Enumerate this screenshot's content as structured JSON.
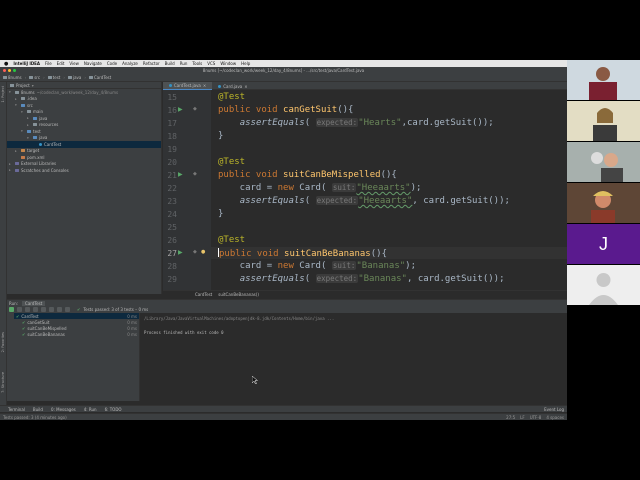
{
  "menubar": {
    "apple": "",
    "app": "IntelliJ IDEA",
    "items": [
      "File",
      "Edit",
      "View",
      "Navigate",
      "Code",
      "Analyze",
      "Refactor",
      "Build",
      "Run",
      "Tools",
      "VCS",
      "Window",
      "Help"
    ],
    "right": ""
  },
  "window": {
    "title": "8nums [~/codeclan_work/week_12/day_4/8nums] - .../src/test/java/CardTest.java"
  },
  "navbar": [
    "8nums",
    "src",
    "test",
    "java",
    "CardTest"
  ],
  "project": {
    "header": "Project",
    "rows": [
      {
        "label": "8nums",
        "detail": "~/codeclan_work/week_12/day_4/8nums",
        "icon": "folder",
        "depth": 0,
        "open": true
      },
      {
        "label": ".idea",
        "detail": "",
        "icon": "folder",
        "depth": 1,
        "open": false
      },
      {
        "label": "src",
        "detail": "",
        "icon": "folder",
        "depth": 1,
        "open": true
      },
      {
        "label": "main",
        "detail": "",
        "icon": "folder",
        "depth": 2,
        "open": true
      },
      {
        "label": "java",
        "detail": "",
        "icon": "folder",
        "depth": 3,
        "open": false
      },
      {
        "label": "resources",
        "detail": "",
        "icon": "folder",
        "depth": 3,
        "open": false
      },
      {
        "label": "test",
        "detail": "",
        "icon": "folder",
        "depth": 2,
        "open": true
      },
      {
        "label": "java",
        "detail": "",
        "icon": "folder",
        "depth": 3,
        "open": true
      },
      {
        "label": "CardTest",
        "detail": "",
        "icon": "class",
        "depth": 4,
        "open": false,
        "selected": true
      },
      {
        "label": "target",
        "detail": "",
        "icon": "folder",
        "depth": 1,
        "open": false
      },
      {
        "label": "pom.xml",
        "detail": "",
        "icon": "file",
        "depth": 1,
        "open": false
      },
      {
        "label": "External Libraries",
        "detail": "",
        "icon": "lib",
        "depth": 0,
        "open": false
      },
      {
        "label": "Scratches and Consoles",
        "detail": "",
        "icon": "lib",
        "depth": 0,
        "open": false
      }
    ]
  },
  "tabs": [
    {
      "label": "CardTest.java",
      "active": true
    },
    {
      "label": "Card.java",
      "active": false
    }
  ],
  "editor": {
    "lines": [
      {
        "n": "15",
        "tokens": [
          [
            "an",
            "@Test"
          ]
        ]
      },
      {
        "n": "16",
        "tokens": [
          [
            "kw",
            "public void "
          ],
          [
            "fn",
            "canGetSuit"
          ],
          [
            "",
            "(){"
          ]
        ]
      },
      {
        "n": "17",
        "tokens": [
          [
            "",
            "    "
          ],
          [
            "it",
            "assertEquals"
          ],
          [
            "",
            "( "
          ],
          [
            "hint",
            "expected:"
          ],
          [
            "st",
            "\"Hearts\""
          ],
          [
            "",
            ",card.getSuit());"
          ]
        ]
      },
      {
        "n": "18",
        "tokens": [
          [
            "",
            "}"
          ]
        ]
      },
      {
        "n": "19",
        "tokens": []
      },
      {
        "n": "20",
        "tokens": [
          [
            "an",
            "@Test"
          ]
        ]
      },
      {
        "n": "21",
        "tokens": [
          [
            "kw",
            "public void "
          ],
          [
            "fn",
            "suitCanBeMispelled"
          ],
          [
            "",
            "(){"
          ]
        ]
      },
      {
        "n": "22",
        "tokens": [
          [
            "",
            "    card = "
          ],
          [
            "kw",
            "new "
          ],
          [
            "",
            "Card( "
          ],
          [
            "hint",
            "suit:"
          ],
          [
            "sttypo",
            "\"Heeaarts\""
          ],
          [
            "",
            ");"
          ]
        ]
      },
      {
        "n": "23",
        "tokens": [
          [
            "",
            "    "
          ],
          [
            "it",
            "assertEquals"
          ],
          [
            "",
            "( "
          ],
          [
            "hint",
            "expected:"
          ],
          [
            "sttypo",
            "\"Heeaarts\""
          ],
          [
            "",
            ", card.getSuit());"
          ]
        ]
      },
      {
        "n": "24",
        "tokens": [
          [
            "",
            "}"
          ]
        ]
      },
      {
        "n": "25",
        "tokens": []
      },
      {
        "n": "26",
        "tokens": [
          [
            "an",
            "@Test"
          ]
        ]
      },
      {
        "n": "27",
        "tokens": [
          [
            "caret",
            ""
          ],
          [
            "kw",
            "public void "
          ],
          [
            "fn",
            "suitCanBeBananas"
          ],
          [
            "",
            "(){"
          ]
        ],
        "current": true
      },
      {
        "n": "28",
        "tokens": [
          [
            "",
            "    card = "
          ],
          [
            "kw",
            "new "
          ],
          [
            "",
            "Card( "
          ],
          [
            "hint",
            "suit:"
          ],
          [
            "st",
            "\"Bananas\""
          ],
          [
            "",
            ");"
          ]
        ]
      },
      {
        "n": "29",
        "tokens": [
          [
            "",
            "    "
          ],
          [
            "it",
            "assertEquals"
          ],
          [
            "",
            "( "
          ],
          [
            "hint",
            "expected:"
          ],
          [
            "st",
            "\"Bananas\""
          ],
          [
            "",
            ", card.getSuit());"
          ]
        ]
      }
    ],
    "run_markers": [
      "16",
      "21",
      "27"
    ],
    "bulb_line": "27"
  },
  "breadcrumb": [
    "CardTest",
    "suitCanBeBananas()"
  ],
  "run": {
    "tab_label": "Run:",
    "config": "CardTest",
    "status": "Tests passed: 3 of 3 tests – 0 ms",
    "tree": [
      {
        "label": "CardTest",
        "time": "0 ms",
        "selected": true
      },
      {
        "label": "canGetSuit",
        "time": "0 ms"
      },
      {
        "label": "suitCanBeMispelled",
        "time": "0 ms"
      },
      {
        "label": "suitCanBeBananas",
        "time": "0 ms"
      }
    ],
    "console": [
      "/Library/Java/JavaVirtualMachines/adoptopenjdk-8.jdk/Contents/Home/bin/java ...",
      "",
      "Process finished with exit code 0"
    ]
  },
  "bottom_tools": [
    "Terminal",
    "Build",
    "0: Messages",
    "4: Run",
    "6: TODO"
  ],
  "bottom_right": "Event Log",
  "status": {
    "left": "Tests passed: 3 (4 minutes ago)",
    "right": [
      "27:5",
      "LF",
      "UTF-8",
      "4 spaces"
    ]
  },
  "participants": [
    {
      "name": "",
      "kind": "video",
      "bg": "#c9d6de"
    },
    {
      "name": "",
      "kind": "video",
      "bg": "#d9d2b8"
    },
    {
      "name": "",
      "kind": "video",
      "bg": "#9aa3a0"
    },
    {
      "name": "",
      "kind": "video",
      "bg": "#6e4d3a"
    },
    {
      "name": "",
      "kind": "initial",
      "initial": "J",
      "bg": "#5a1a8e"
    },
    {
      "name": "",
      "kind": "anon",
      "bg": "#eeeeee"
    }
  ],
  "colors": {
    "ide_bg": "#2b2b2b",
    "panel": "#3c3f41",
    "keyword": "#cc7832",
    "annotation": "#bbb529",
    "method": "#ffc66d",
    "string": "#6a8759",
    "test_pass": "#59a869",
    "accent_purple": "#5a1a8e"
  }
}
